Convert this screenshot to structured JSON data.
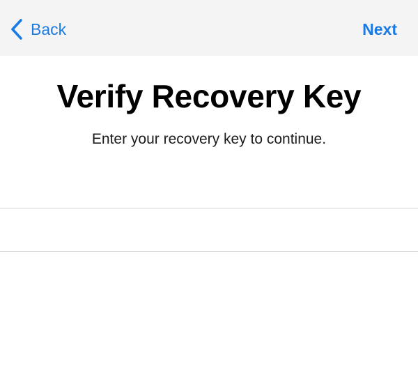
{
  "nav": {
    "back_label": "Back",
    "next_label": "Next"
  },
  "main": {
    "title": "Verify Recovery Key",
    "subtitle": "Enter your recovery key to continue.",
    "key_input": {
      "value": "",
      "placeholder": ""
    }
  },
  "colors": {
    "accent": "#1a7ce2",
    "nav_background": "#f4f4f5",
    "separator": "#d6d6d8"
  },
  "icons": {
    "back": "chevron-left-icon"
  }
}
